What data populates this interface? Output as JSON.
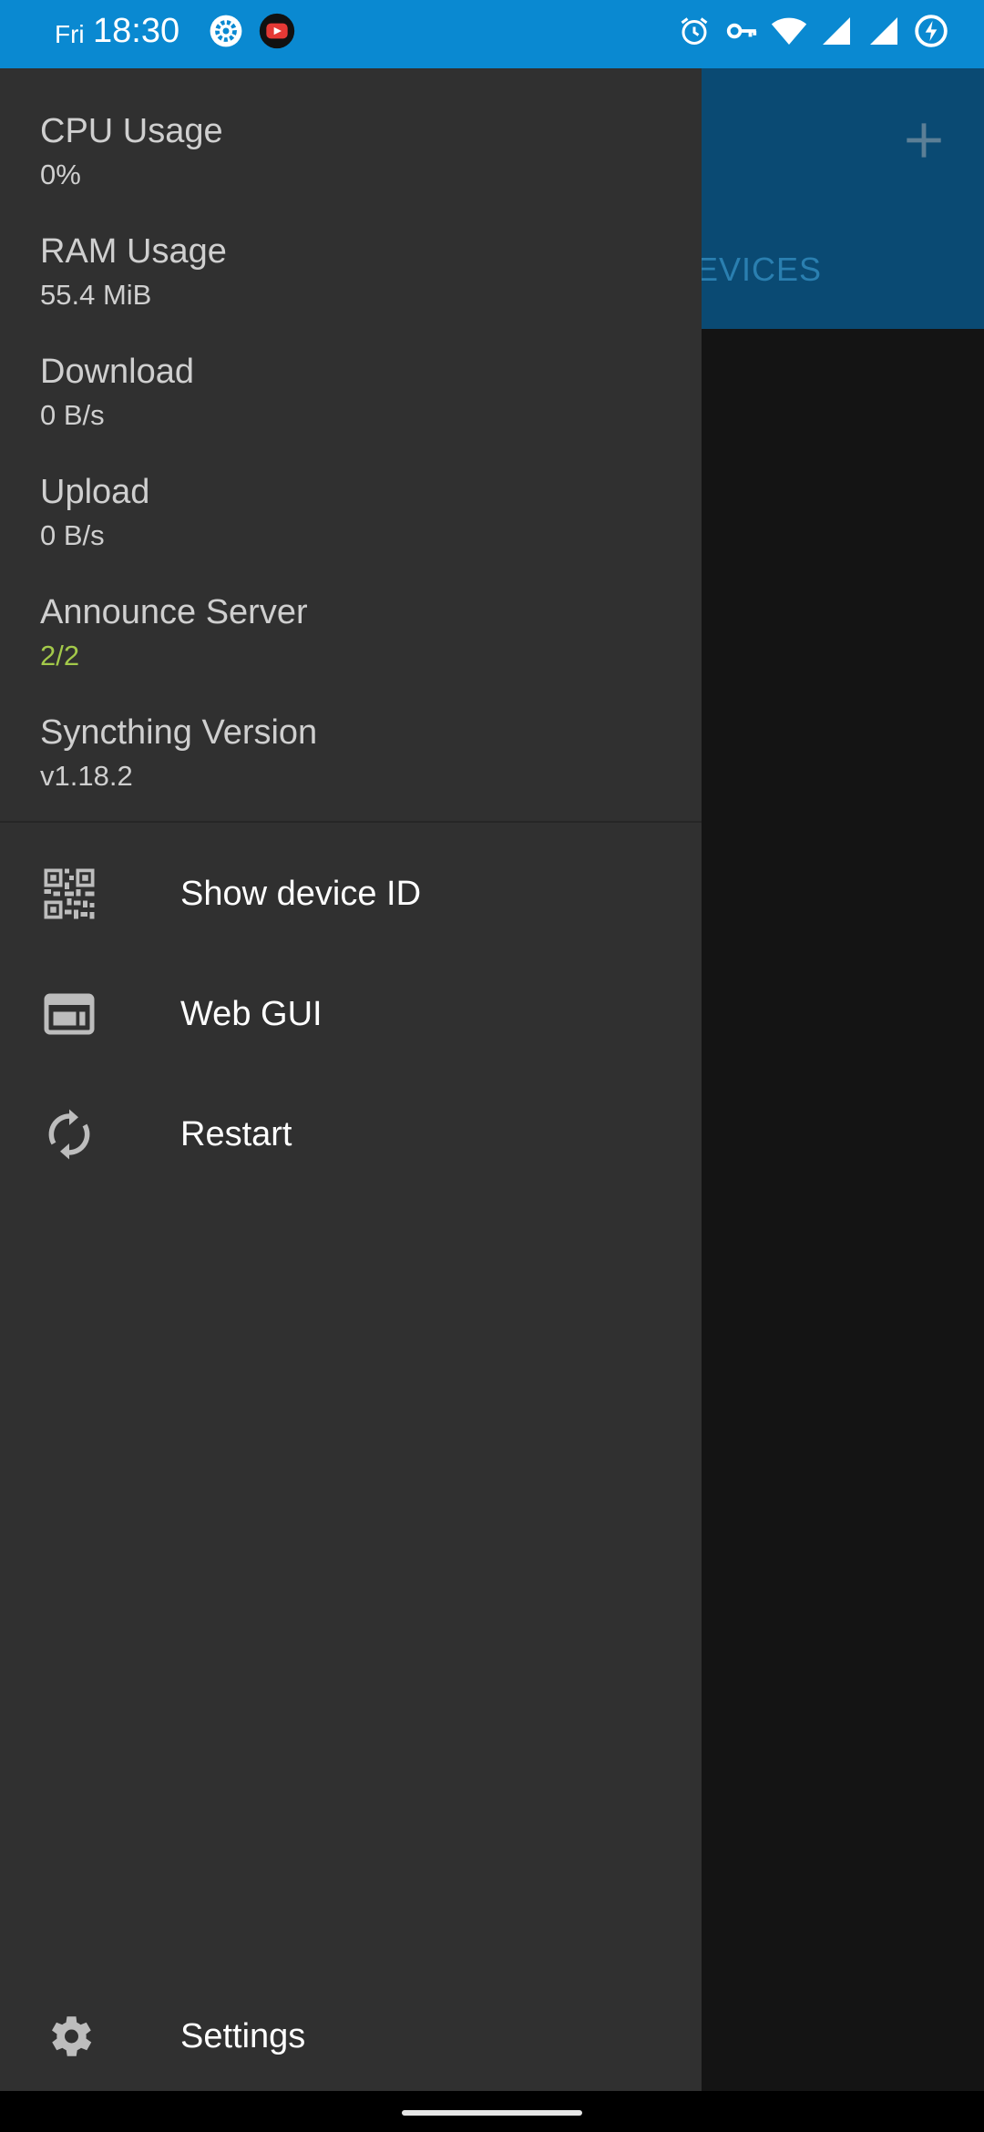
{
  "status_bar": {
    "day": "Fri",
    "time": "18:30",
    "left_icons": [
      "gear-notification-icon",
      "youtube-notification-icon"
    ],
    "right_icons": [
      "alarm-icon",
      "vpn-key-icon",
      "wifi-icon",
      "signal-icon",
      "signal-icon",
      "battery-charging-icon"
    ],
    "background": "#0a89d1"
  },
  "app": {
    "add_icon": "plus-icon",
    "tab_visible_text": "EVICES"
  },
  "drawer": {
    "stats": [
      {
        "label": "CPU Usage",
        "value": "0%"
      },
      {
        "label": "RAM Usage",
        "value": "55.4 MiB"
      },
      {
        "label": "Download",
        "value": "0 B/s"
      },
      {
        "label": "Upload",
        "value": "0 B/s"
      },
      {
        "label": "Announce Server",
        "value": "2/2"
      },
      {
        "label": "Syncthing Version",
        "value": "v1.18.2"
      }
    ],
    "menu": [
      {
        "label": "Show device ID",
        "icon": "qr-code-icon"
      },
      {
        "label": "Web GUI",
        "icon": "web-gui-icon"
      },
      {
        "label": "Restart",
        "icon": "restart-icon"
      }
    ],
    "settings": {
      "label": "Settings",
      "icon": "settings-icon"
    },
    "colors": {
      "ok_value": "#a3c94a",
      "drawer_bg": "#303030"
    }
  }
}
